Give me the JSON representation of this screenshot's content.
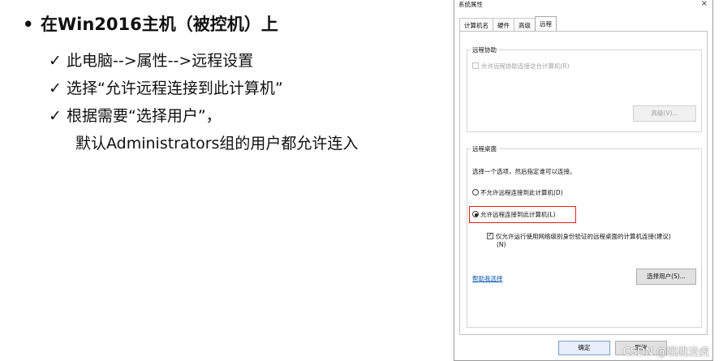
{
  "slide": {
    "heading_bullet": "•",
    "heading": "在Win2016主机（被控机）上",
    "check_mark": "✓",
    "items": [
      "此电脑-->属性-->远程设置",
      "选择“允许远程连接到此计算机”",
      "根据需要“选择用户”，"
    ],
    "continuation": "默认Administrators组的用户都允许连入"
  },
  "dialog": {
    "title": "系统属性",
    "close_glyph": "×",
    "tabs": [
      "计算机名",
      "硬件",
      "高级",
      "远程"
    ],
    "active_tab": "远程",
    "remote_assistance": {
      "legend": "远程协助",
      "checkbox_label": "允许远程协助连接这台计算机(R)",
      "advanced_button": "高级(V)..."
    },
    "remote_desktop": {
      "legend": "远程桌面",
      "instruction": "选择一个选项，然后指定谁可以连接。",
      "option_disallow": "不允许远程连接到此计算机(D)",
      "option_allow": "允许远程连接到此计算机(L)",
      "nla_checkbox_line1": "仅允许运行使用网络级别身份验证的远程桌面的计算机连接(建议)",
      "nla_checkbox_line2": "(N)",
      "help_link": "帮助我选择",
      "select_users_button": "选择用户(S)..."
    },
    "ok_button": "确定",
    "cancel_button": "取消"
  },
  "watermark": "CSDN @跳跳没虎",
  "colors": {
    "highlight_border": "#e0221c",
    "link": "#0b57b0"
  }
}
